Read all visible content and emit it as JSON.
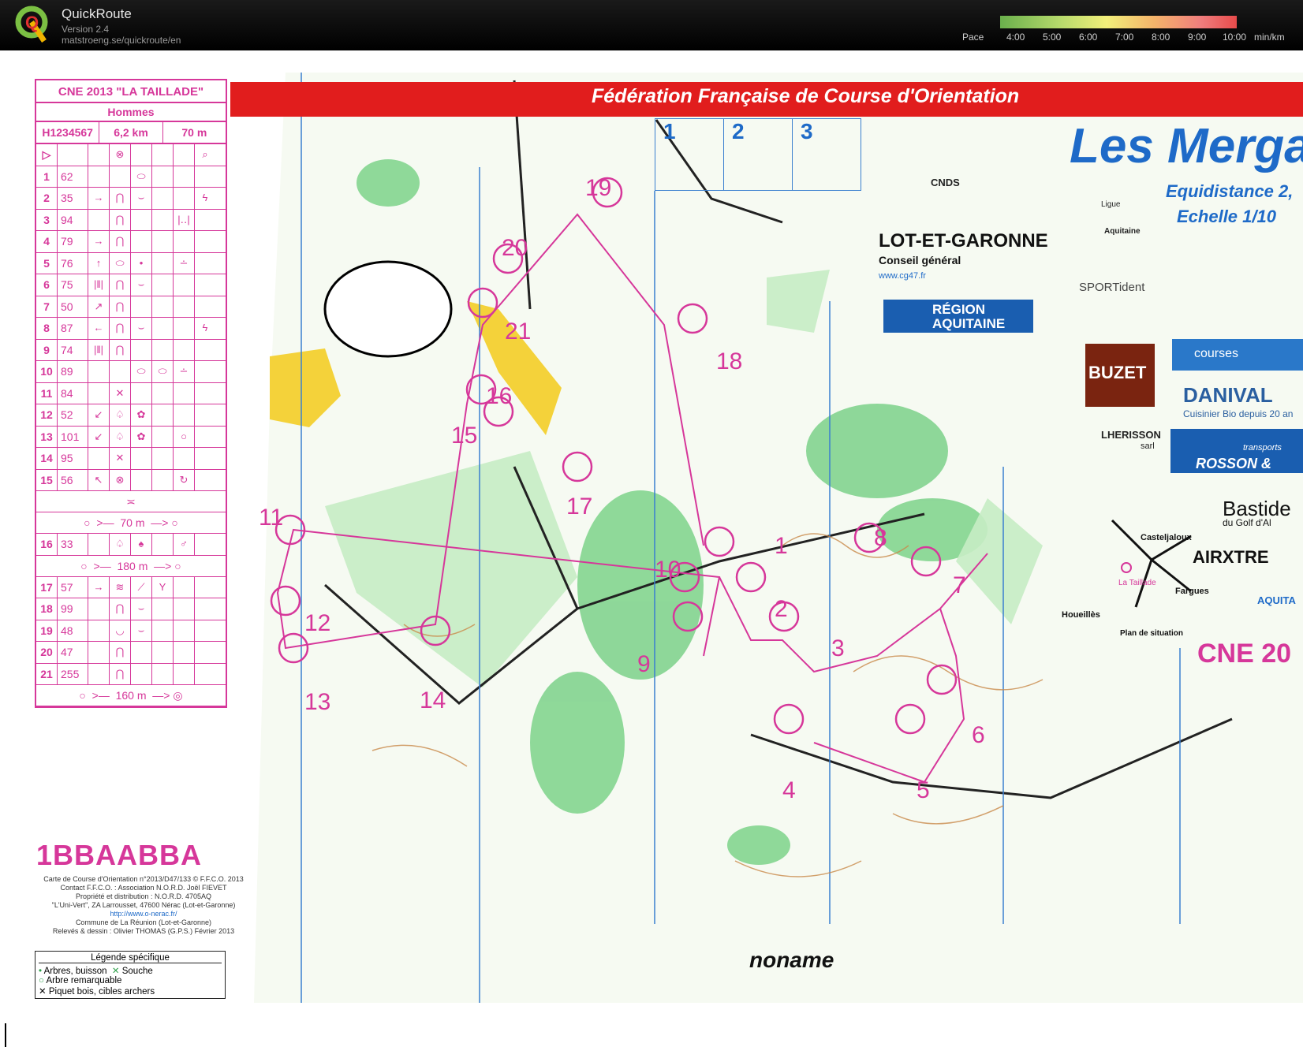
{
  "app": {
    "title": "QuickRoute",
    "version": "Version 2.4",
    "url": "matstroeng.se/quickroute/en"
  },
  "pace_scale": {
    "label": "Pace",
    "ticks": [
      "4:00",
      "5:00",
      "6:00",
      "7:00",
      "8:00",
      "9:00",
      "10:00"
    ],
    "unit": "min/km",
    "colors": [
      "#6ab04c",
      "#b5d96b",
      "#f2ef7a",
      "#f4b46a",
      "#ef7d7d",
      "#e84b4b"
    ]
  },
  "map": {
    "banner": "Fédération Française de Course d'Orientation",
    "club_title": "Les Mergan",
    "subtitle1": "Equidistance 2,",
    "subtitle2": "Echelle 1/10",
    "boxes": [
      "1",
      "2",
      "3"
    ],
    "event_tag": "CNE 20",
    "bib": "1BBAABBA",
    "noname": "noname",
    "sponsors": {
      "cnds": "CNDS",
      "lot_et_garonne": "LOT-ET-GARONNE",
      "conseil": "Conseil général",
      "cg47": "www.cg47.fr",
      "region": "RÉGION AQUITAINE",
      "ligue": "Ligue",
      "aquitaine": "Aquitaine",
      "sportident": "SPORTident",
      "courses": "courses",
      "buzet": "BUZET",
      "danival": "DANIVAL",
      "danival_sub": "Cuisinier Bio depuis 20 an",
      "lherisson": "LHERISSON",
      "sarl": "sarl",
      "rosson": "ROSSON &",
      "transports": "transports",
      "bastide": "Bastide",
      "golf": "du Golf d'Al",
      "airxtrem": "AIRXTRE",
      "ca": "AQUITA"
    },
    "situation": {
      "casteljaloux": "Casteljaloux",
      "la_taillade": "La Taillade",
      "fargues": "Fargues",
      "houeilles": "Houeillès",
      "plan": "Plan de situation"
    },
    "legal_lines": [
      "Carte de Course d'Orientation n°2013/D47/133 © F.F.C.O. 2013",
      "Contact F.F.C.O. : Association N.O.R.D. Joël FIEVET",
      "Propriété et distribution : N.O.R.D. 4705AQ",
      "\"L'Uni-Vert\", ZA Larrousset, 47600 Nérac (Lot-et-Garonne)",
      "http://www.o-nerac.fr/",
      "Commune de La Réunion (Lot-et-Garonne)",
      "Relevés & dessin : Olivier THOMAS (G.P.S.) Février 2013"
    ],
    "legend": {
      "title": "Légende spécifique",
      "items": [
        "Arbres, buisson",
        "Souche",
        "Arbre remarquable",
        "Piquet bois, cibles archers"
      ]
    },
    "controls": [
      {
        "label": "1"
      },
      {
        "label": "2"
      },
      {
        "label": "3"
      },
      {
        "label": "4"
      },
      {
        "label": "5"
      },
      {
        "label": "6"
      },
      {
        "label": "7"
      },
      {
        "label": "8"
      },
      {
        "label": "9"
      },
      {
        "label": "10"
      },
      {
        "label": "11"
      },
      {
        "label": "12"
      },
      {
        "label": "13"
      },
      {
        "label": "14"
      },
      {
        "label": "15"
      },
      {
        "label": "16"
      },
      {
        "label": "17"
      },
      {
        "label": "18"
      },
      {
        "label": "19"
      },
      {
        "label": "20"
      },
      {
        "label": "21"
      }
    ]
  },
  "description": {
    "title": "CNE 2013 \"LA TAILLADE\"",
    "category": "Hommes",
    "course_code": "H1234567",
    "length": "6,2 km",
    "climb": "70 m",
    "rows": [
      {
        "n": "1",
        "code": "62",
        "s": [
          "",
          "",
          "⬭",
          "",
          "",
          ""
        ]
      },
      {
        "n": "2",
        "code": "35",
        "s": [
          "→",
          "⋂",
          "⌣",
          "",
          "",
          "ϟ"
        ]
      },
      {
        "n": "3",
        "code": "94",
        "s": [
          "",
          "⋂",
          "",
          "",
          "|‥|",
          ""
        ]
      },
      {
        "n": "4",
        "code": "79",
        "s": [
          "→",
          "⋂",
          "",
          "",
          "",
          ""
        ]
      },
      {
        "n": "5",
        "code": "76",
        "s": [
          "↑",
          "⬭",
          "•",
          "",
          "∸",
          ""
        ]
      },
      {
        "n": "6",
        "code": "75",
        "s": [
          "|‖|",
          "⋂",
          "⌣",
          "",
          "",
          ""
        ]
      },
      {
        "n": "7",
        "code": "50",
        "s": [
          "↗",
          "⋂",
          "",
          "",
          "",
          ""
        ]
      },
      {
        "n": "8",
        "code": "87",
        "s": [
          "←",
          "⋂",
          "⌣",
          "",
          "",
          "ϟ"
        ]
      },
      {
        "n": "9",
        "code": "74",
        "s": [
          "|‖|",
          "⋂",
          "",
          "",
          "",
          ""
        ]
      },
      {
        "n": "10",
        "code": "89",
        "s": [
          "",
          "",
          "⬭",
          "⬭",
          "∸",
          ""
        ]
      },
      {
        "n": "11",
        "code": "84",
        "s": [
          "",
          "✕",
          "",
          "",
          "",
          ""
        ]
      },
      {
        "n": "12",
        "code": "52",
        "s": [
          "↙",
          "♤",
          "✿",
          "",
          "",
          ""
        ]
      },
      {
        "n": "13",
        "code": "101",
        "s": [
          "↙",
          "♤",
          "✿",
          "",
          "○",
          ""
        ]
      },
      {
        "n": "14",
        "code": "95",
        "s": [
          "",
          "✕",
          "",
          "",
          "",
          ""
        ]
      },
      {
        "n": "15",
        "code": "56",
        "s": [
          "↖",
          "⊗",
          "",
          "",
          "↻",
          ""
        ]
      }
    ],
    "marked1": "70 m",
    "row16": {
      "n": "16",
      "code": "33",
      "s": [
        "",
        "♤",
        "♠",
        "",
        "♂",
        ""
      ]
    },
    "marked2": "180 m",
    "rows_b": [
      {
        "n": "17",
        "code": "57",
        "s": [
          "→",
          "≋",
          "⟋",
          "Y",
          "",
          ""
        ]
      },
      {
        "n": "18",
        "code": "99",
        "s": [
          "",
          "⋂",
          "⌣",
          "",
          "",
          ""
        ]
      },
      {
        "n": "19",
        "code": "48",
        "s": [
          "",
          "◡",
          "⌣",
          "",
          "",
          ""
        ]
      },
      {
        "n": "20",
        "code": "47",
        "s": [
          "",
          "⋂",
          "",
          "",
          "",
          ""
        ]
      },
      {
        "n": "21",
        "code": "255",
        "s": [
          "",
          "⋂",
          "",
          "",
          "",
          ""
        ]
      }
    ],
    "finish": "160 m"
  }
}
